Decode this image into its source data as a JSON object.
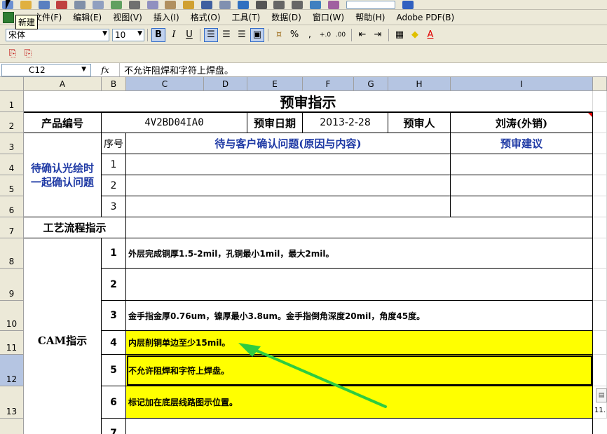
{
  "tooltip": "新建",
  "menu": [
    "文件(F)",
    "编辑(E)",
    "视图(V)",
    "插入(I)",
    "格式(O)",
    "工具(T)",
    "数据(D)",
    "窗口(W)",
    "帮助(H)",
    "Adobe PDF(B)"
  ],
  "format_bar": {
    "font": "宋体",
    "size": "10",
    "bold": "B",
    "italic": "I",
    "underline": "U",
    "percent": "%",
    "comma": ",",
    "inc_dec": "+.0",
    "dec_dec": ".00"
  },
  "formula_bar": {
    "name_box": "C12",
    "fx": "fx",
    "content": "不允许阻焊和字符上焊盘。"
  },
  "columns": [
    "A",
    "B",
    "C",
    "D",
    "E",
    "F",
    "G",
    "H",
    "I"
  ],
  "rows": [
    "1",
    "2",
    "3",
    "4",
    "5",
    "6",
    "7",
    "8",
    "9",
    "10",
    "11",
    "12",
    "13",
    "7"
  ],
  "sheet": {
    "title": "预审指示",
    "product_label": "产品编号",
    "product_value": "4V2BD04IA0",
    "date_label": "预审日期",
    "date_value": "2013-2-28",
    "reviewer_label": "预审人",
    "reviewer_value": "刘涛(外销)",
    "seq_label": "序号",
    "question_label": "待与客户确认问题(原因与内容)",
    "suggestion_label": "预审建议",
    "confirm_line1": "待确认光绘时",
    "confirm_line2": "一起确认问题",
    "confirm_nums": [
      "1",
      "2",
      "3"
    ],
    "process_label": "工艺流程指示",
    "cam_label": "CAM指示",
    "cam_rows": [
      {
        "num": "1",
        "text": "外层完成铜厚1.5-2mil，孔铜最小1mil，最大2mil。"
      },
      {
        "num": "2",
        "text": ""
      },
      {
        "num": "3",
        "text": "金手指金厚0.76um，镍厚最小3.8um。金手指倒角深度20mil，角度45度。"
      },
      {
        "num": "4",
        "text": "内层削铜单边至少15mil。"
      },
      {
        "num": "5",
        "text": "不允许阻焊和字符上焊盘。"
      },
      {
        "num": "6",
        "text": "标记加在底层线路图示位置。"
      },
      {
        "num": "7",
        "text": ""
      }
    ],
    "side_note": "11."
  },
  "colors": {
    "highlight": "#ffff00",
    "arrow": "#2ecc40",
    "header_blue": "#1f3aa5",
    "selection": "#b5c5e2"
  }
}
